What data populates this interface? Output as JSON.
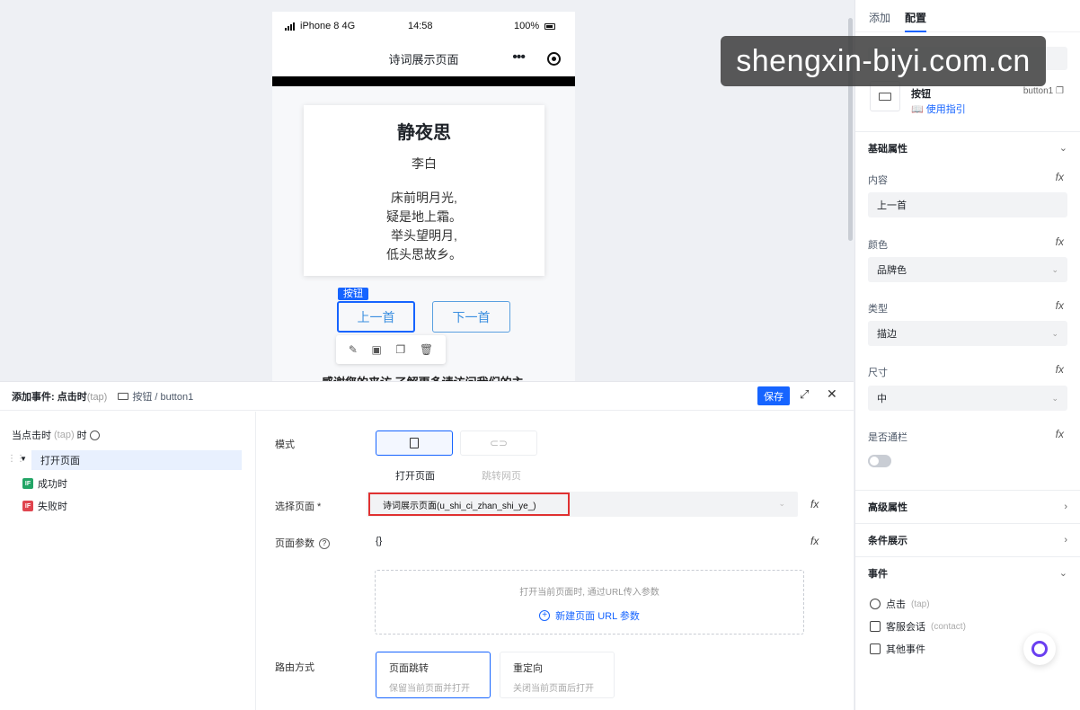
{
  "phone": {
    "carrier": "iPhone 8  4G",
    "time": "14:58",
    "battery": "100%",
    "nav_title": "诗词展示页面",
    "more": "•••",
    "poem": {
      "title": "静夜思",
      "author": "李白",
      "lines": [
        "床前明月光,",
        "疑是地上霜。",
        "举头望明月,",
        "低头思故乡。"
      ]
    },
    "selected_tag": "按钮",
    "prev_button": "上一首",
    "next_button": "下一首",
    "bottom_text": "感谢您的来访,了解更多请访问我们的主"
  },
  "watermark": "shengxin-biyi.com.cn",
  "right_panel": {
    "tabs": [
      "添加",
      "配置"
    ],
    "component_name": "按钮",
    "component_id": "button1",
    "guide_link": "使用指引",
    "basic_section": "基础属性",
    "content_label": "内容",
    "content_value": "上一首",
    "color_label": "颜色",
    "color_value": "品牌色",
    "type_label": "类型",
    "type_value": "描边",
    "size_label": "尺寸",
    "size_value": "中",
    "full_label": "是否通栏",
    "full_value": false,
    "advanced_section": "高级属性",
    "condition_section": "条件展示",
    "events_section": "事件",
    "events": [
      {
        "label": "点击",
        "sub": "(tap)"
      },
      {
        "label": "客服会话",
        "sub": "(contact)"
      },
      {
        "label": "其他事件",
        "sub": ""
      }
    ],
    "fx": "fx"
  },
  "event_panel": {
    "title": "添加事件: 点击时",
    "title_tap": "(tap)",
    "breadcrumb": "按钮 / button1",
    "save": "保存",
    "trigger": "当点击时",
    "trigger_tap": "(tap)",
    "trigger_suffix": "时",
    "action": "打开页面",
    "success": "成功时",
    "failure": "失败时",
    "if_badge": "IF",
    "mode_label": "模式",
    "mode_open": "打开页面",
    "mode_jump": "跳转网页",
    "select_page_label": "选择页面 *",
    "select_page_value": "诗词展示页面(u_shi_ci_zhan_shi_ye_)",
    "params_label": "页面参数",
    "params_value": "{}",
    "params_hint": "打开当前页面时, 通过URL传入参数",
    "params_add": "新建页面 URL 参数",
    "route_label": "路由方式",
    "route_options": [
      {
        "title": "页面跳转",
        "desc": "保留当前页面并打开"
      },
      {
        "title": "重定向",
        "desc": "关闭当前页面后打开"
      }
    ]
  }
}
